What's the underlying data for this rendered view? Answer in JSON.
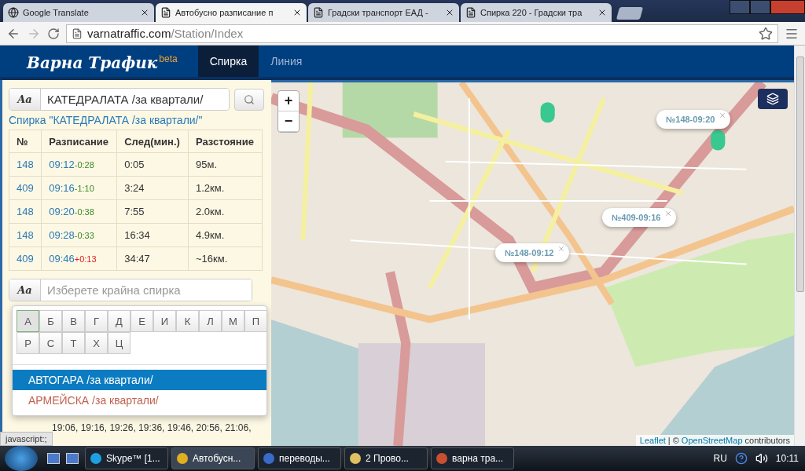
{
  "browser": {
    "tabs": [
      {
        "title": "Google Translate",
        "selected": false
      },
      {
        "title": "Автобусно разписание п",
        "selected": true
      },
      {
        "title": "Градски транспорт ЕАД -",
        "selected": false
      },
      {
        "title": "Спирка 220 - Градски тра",
        "selected": false
      }
    ],
    "url_host": "varnatraffic.com",
    "url_path": "/Station/Index"
  },
  "navbar": {
    "brand": "Варна Трафик",
    "badge": "beta",
    "items": [
      {
        "label": "Спирка",
        "selected": true
      },
      {
        "label": "Линия",
        "selected": false
      }
    ]
  },
  "stop_search": {
    "toggle": "Aa",
    "value": "КАТЕДРАЛАТА /за квартали/"
  },
  "stop_title": "Спирка \"КАТЕДРАЛАТА /за квартали/\"",
  "schedule": {
    "columns": [
      "№",
      "Разписание",
      "След(мин.)",
      "Разстояние"
    ],
    "rows": [
      {
        "route": "148",
        "time": "09:12",
        "delta": "-0:28",
        "color": "#3a8a2a",
        "next": "0:05",
        "distance": "95м."
      },
      {
        "route": "409",
        "time": "09:16",
        "delta": "-1:10",
        "color": "#3a8a2a",
        "next": "3:24",
        "distance": "1.2км."
      },
      {
        "route": "148",
        "time": "09:20",
        "delta": "-0:38",
        "color": "#3a8a2a",
        "next": "7:55",
        "distance": "2.0км."
      },
      {
        "route": "148",
        "time": "09:28",
        "delta": "-0:33",
        "color": "#3a8a2a",
        "next": "16:34",
        "distance": "4.9км."
      },
      {
        "route": "409",
        "time": "09:46",
        "delta": "+0:13",
        "color": "#e02020",
        "next": "34:47",
        "distance": "~16км."
      }
    ]
  },
  "destination": {
    "toggle": "Aa",
    "placeholder": "Изберете крайна спирка",
    "letters": [
      {
        "label": "А",
        "selected": true
      },
      {
        "label": "Б",
        "selected": false
      },
      {
        "label": "В",
        "selected": false
      },
      {
        "label": "Г",
        "selected": false
      },
      {
        "label": "Д",
        "selected": false
      },
      {
        "label": "Е",
        "selected": false
      },
      {
        "label": "И",
        "selected": false
      },
      {
        "label": "К",
        "selected": false
      },
      {
        "label": "Л",
        "selected": false
      },
      {
        "label": "М",
        "selected": false
      },
      {
        "label": "П",
        "selected": false
      },
      {
        "label": "Р",
        "selected": false
      },
      {
        "label": "С",
        "selected": false
      },
      {
        "label": "Т",
        "selected": false
      },
      {
        "label": "Х",
        "selected": false
      },
      {
        "label": "Ц",
        "selected": false
      }
    ],
    "results": [
      {
        "label": "АВТОГАРА /за квартали/",
        "selected": true
      },
      {
        "label": "АРМЕЙСКА /за квартали/",
        "selected": false
      }
    ]
  },
  "times_lines": [
    "19:06, 19:16, 19:26, 19:36, 19:46, 20:56, 21:06,"
  ],
  "map": {
    "zoom_in": "+",
    "zoom_out": "−",
    "popups": [
      {
        "label": "№148-09:20"
      },
      {
        "label": "№409-09:16"
      },
      {
        "label": "№148-09:12"
      }
    ],
    "attribution_link": "Leaflet",
    "attribution_sep": "| ©",
    "attribution_osm": "OpenStreetMap",
    "attribution_rest": "contributors"
  },
  "status_bar": "javascript:;",
  "taskbar": {
    "items": [
      {
        "label": "Skype™ [1...",
        "selected": false
      },
      {
        "label": "Автобусн...",
        "selected": true
      },
      {
        "label": "переводы...",
        "selected": false
      },
      {
        "label": "2 Прово...",
        "selected": false
      },
      {
        "label": "варна тра...",
        "selected": false
      }
    ],
    "language": "RU",
    "clock": "10:11"
  }
}
